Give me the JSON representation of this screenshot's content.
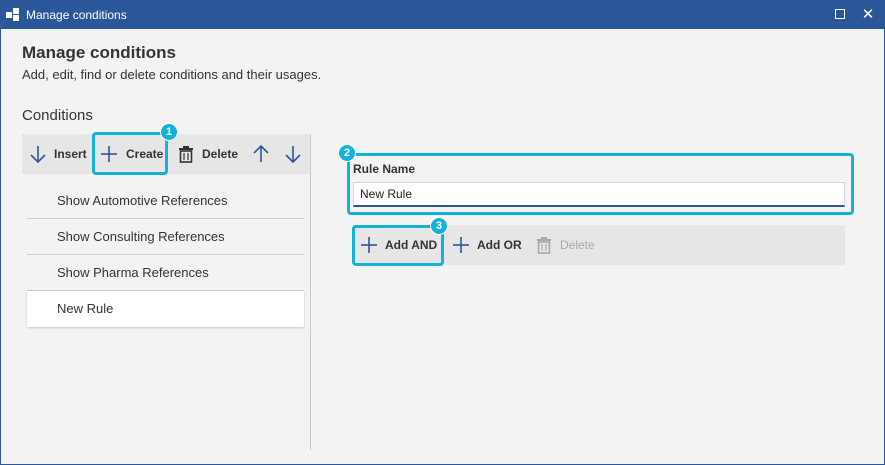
{
  "window": {
    "title": "Manage conditions",
    "maximize_icon": "maximize-icon",
    "close_label": "✕"
  },
  "page": {
    "heading": "Manage conditions",
    "subheading": "Add, edit, find or delete conditions and their usages."
  },
  "conditions": {
    "label": "Conditions",
    "toolbar": {
      "insert": "Insert",
      "create": "Create",
      "delete": "Delete"
    },
    "items": [
      {
        "label": "Show Automotive References"
      },
      {
        "label": "Show Consulting References"
      },
      {
        "label": "Show Pharma References"
      },
      {
        "label": "New Rule",
        "selected": true
      }
    ]
  },
  "rule": {
    "name_label": "Rule Name",
    "name_value": "New Rule",
    "toolbar": {
      "add_and": "Add AND",
      "add_or": "Add OR",
      "delete": "Delete"
    }
  },
  "callouts": [
    "1",
    "2",
    "3"
  ],
  "colors": {
    "titlebar": "#2b579a",
    "highlight": "#14b1d8",
    "icon": "#2b579a",
    "disabled": "#a8a8a8"
  }
}
